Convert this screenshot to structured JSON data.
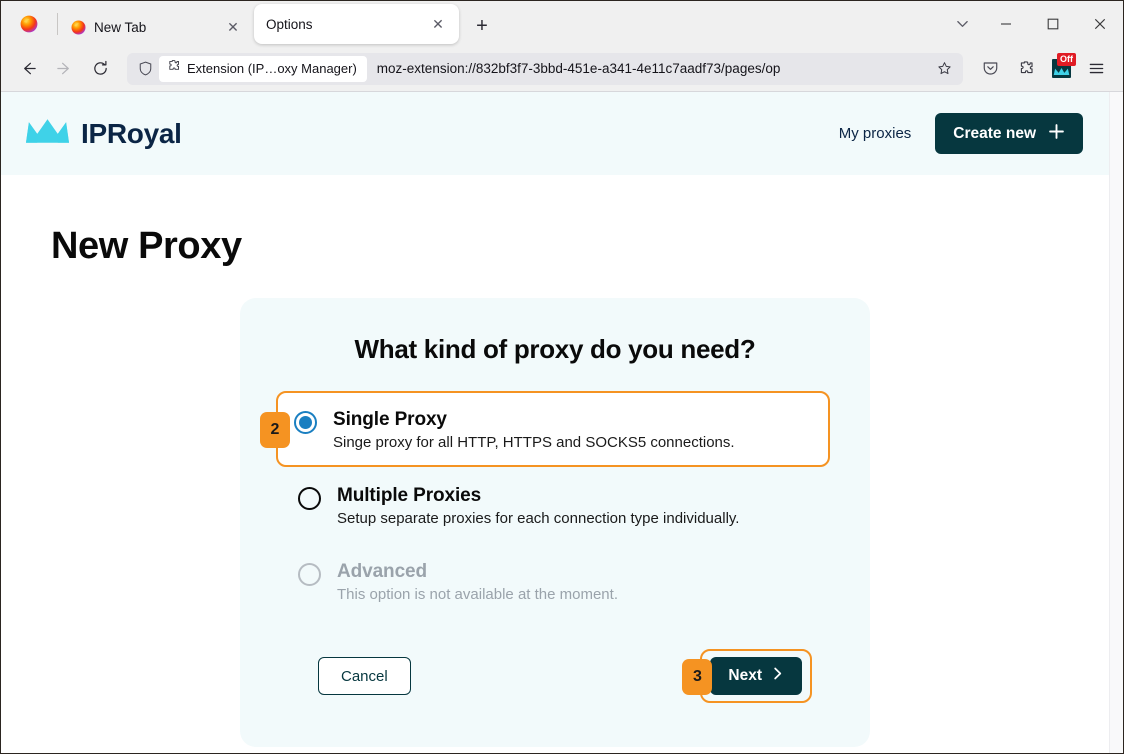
{
  "browser": {
    "app_button_icon": "firefox-logo-icon",
    "tabs": [
      {
        "title": "New Tab",
        "favicon": "firefox-logo-icon",
        "active": false,
        "close_label": "✕"
      },
      {
        "title": "Options",
        "favicon": "none",
        "active": true,
        "close_label": "✕"
      }
    ],
    "new_tab_label": "+",
    "window_controls": {
      "list_all_tabs": "list-all-tabs",
      "minimize": "minimize",
      "maximize": "maximize",
      "close": "close"
    },
    "nav": {
      "back": "back",
      "forward": "forward",
      "reload": "reload"
    },
    "urlbar": {
      "identity_label": "Extension (IP…oxy Manager)",
      "url": "moz-extension://832bf3f7-3bbd-451e-a341-4e11c7aadf73/pages/op",
      "bookmark_star": "bookmark-star"
    },
    "toolbar_right": {
      "pocket": "save-to-pocket",
      "extensions": "extensions-puzzle",
      "iproyal_extension_badge": "Off",
      "app_menu": "hamburger-menu"
    }
  },
  "site": {
    "logo_text": "IPRoyal",
    "nav_link": "My proxies",
    "create_button": "Create new",
    "create_button_icon": "plus-icon"
  },
  "main": {
    "page_title": "New Proxy",
    "card": {
      "heading": "What kind of proxy do you need?",
      "options": [
        {
          "label": "Single Proxy",
          "description": "Singe proxy for all HTTP, HTTPS and SOCKS5 connections.",
          "selected": true,
          "disabled": false,
          "badge": "2"
        },
        {
          "label": "Multiple Proxies",
          "description": "Setup separate proxies for each connection type individually.",
          "selected": false,
          "disabled": false,
          "badge": ""
        },
        {
          "label": "Advanced",
          "description": "This option is not available at the moment.",
          "selected": false,
          "disabled": true,
          "badge": ""
        }
      ],
      "cancel_button": "Cancel",
      "next_button": "Next",
      "next_button_icon": "chevron-right-icon",
      "next_badge": "3"
    }
  },
  "colors": {
    "brand_dark": "#06373f",
    "brand_cyan": "#3fd2e8",
    "navy_text": "#0b2545",
    "card_bg": "#f2fafb",
    "annotation_orange": "#f59322",
    "radio_blue": "#1a7fc1",
    "badge_red": "#e01b24"
  }
}
